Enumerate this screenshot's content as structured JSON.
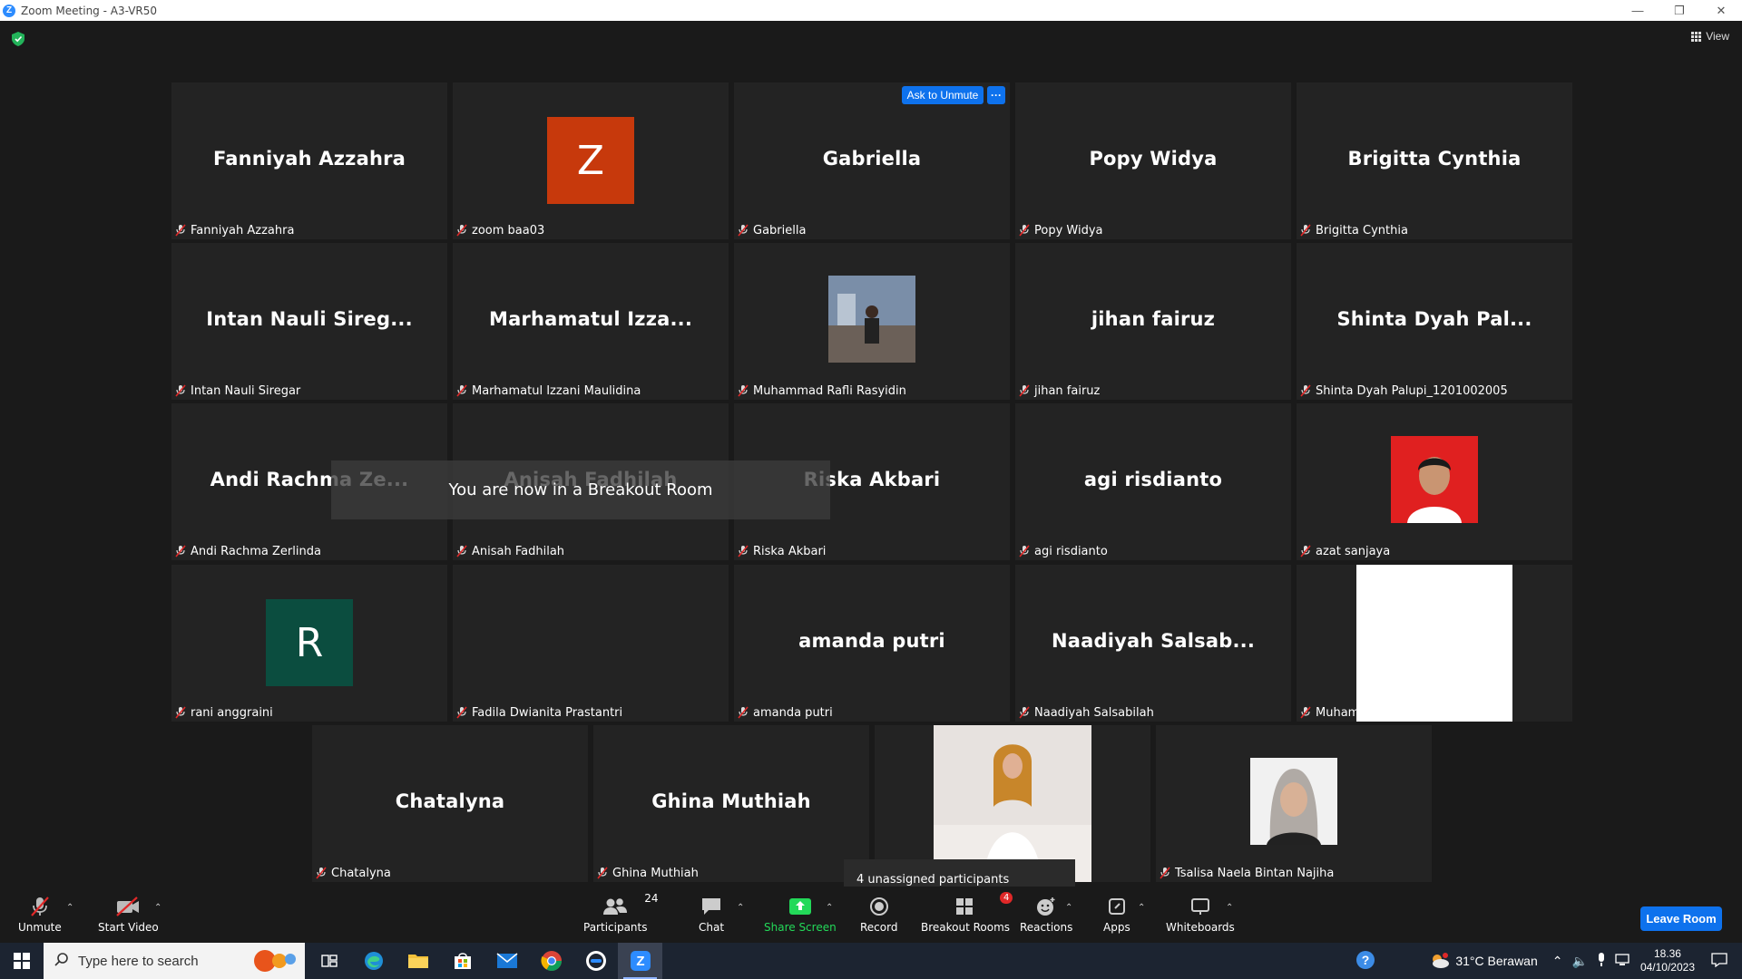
{
  "window": {
    "title": "Zoom Meeting - A3-VR50",
    "app_logo": "Z"
  },
  "view": {
    "label": "View"
  },
  "tiles": [
    {
      "big": "Fanniyah Azzahra",
      "label": "Fanniyah Azzahra"
    },
    {
      "big": "",
      "label": "zoom baa03",
      "avatar_letter": "Z",
      "avatar_color": "#c7390c"
    },
    {
      "big": "Gabriella",
      "label": "Gabriella"
    },
    {
      "big": "Popy Widya",
      "label": "Popy Widya"
    },
    {
      "big": "Brigitta Cynthia",
      "label": "Brigitta Cynthia"
    },
    {
      "big": "Intan Nauli Sireg...",
      "label": "Intan Nauli Siregar"
    },
    {
      "big": "Marhamatul Izza...",
      "label": "Marhamatul Izzani Maulidina"
    },
    {
      "big": "",
      "label": "Muhammad Rafli Rasyidin"
    },
    {
      "big": "jihan fairuz",
      "label": "jihan fairuz"
    },
    {
      "big": "Shinta Dyah Pal...",
      "label": "Shinta Dyah Palupi_1201002005"
    },
    {
      "big": "Andi Rachma Ze...",
      "label": "Andi Rachma Zerlinda"
    },
    {
      "big": "Anisah Fadhilah",
      "label": "Anisah Fadhilah"
    },
    {
      "big": "Riska Akbari",
      "label": "Riska Akbari"
    },
    {
      "big": "agi risdianto",
      "label": "agi risdianto"
    },
    {
      "big": "",
      "label": "azat sanjaya"
    },
    {
      "big": "",
      "label": "rani anggraini",
      "avatar_letter": "R",
      "avatar_color": "#0b4d3f"
    },
    {
      "big": "",
      "label": "Fadila Dwianita Prastantri"
    },
    {
      "big": "amanda putri",
      "label": "amanda putri"
    },
    {
      "big": "Naadiyah Salsab...",
      "label": "Naadiyah Salsabilah"
    },
    {
      "big": "",
      "label": "Muhammad Raehan"
    },
    {
      "big": "Chatalyna",
      "label": "Chatalyna"
    },
    {
      "big": "Ghina Muthiah",
      "label": "Ghina Muthiah"
    },
    {
      "big": "",
      "label": ""
    },
    {
      "big": "",
      "label": "Tsalisa Naela Bintan Najiha"
    }
  ],
  "ask_to_unmute": "Ask to Unmute",
  "more_dots": "···",
  "breakout_toast": "You are now in a Breakout Room",
  "unassigned": "4 unassigned participants",
  "toolbar": {
    "unmute": "Unmute",
    "start_video": "Start Video",
    "participants": "Participants",
    "participants_count": "24",
    "chat": "Chat",
    "share_screen": "Share Screen",
    "record": "Record",
    "breakout_rooms": "Breakout Rooms",
    "breakout_badge": "4",
    "reactions": "Reactions",
    "apps": "Apps",
    "whiteboards": "Whiteboards",
    "leave": "Leave Room"
  },
  "taskbar": {
    "search_placeholder": "Type here to search",
    "weather": "31°C  Berawan",
    "time": "18.36",
    "date": "04/10/2023"
  },
  "colors": {
    "accent": "#0e72ed",
    "share_green": "#23d959",
    "mute_red": "#e02828"
  }
}
